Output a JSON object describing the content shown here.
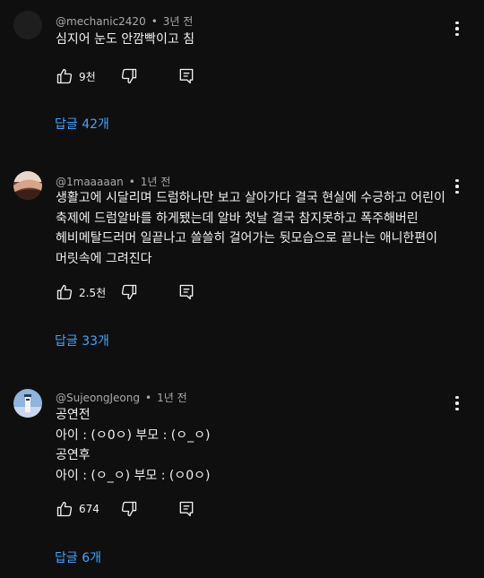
{
  "comments": [
    {
      "author": "@mechanic2420",
      "time": "3년 전",
      "lines": [
        "심지어 눈도 안깜빡이고 침"
      ],
      "likes": "9천",
      "replies": "답글 42개"
    },
    {
      "author": "@1maaaaan",
      "time": "1년 전",
      "lines": [
        "생활고에 시달리며 드럼하나만 보고 살아가다 결국 현실에 수긍하고 어린이",
        "축제에 드럼알바를 하게됐는데 알바 첫날 결국 참지못하고 폭주해버린",
        "헤비메탈드러머 일끝나고 쓸쓸히 걸어가는 뒷모습으로 끝나는 애니한편이",
        "머릿속에 그려진다"
      ],
      "likes": "2.5천",
      "replies": "답글 33개"
    },
    {
      "author": "@SujeongJeong",
      "time": "1년 전",
      "lines": [
        "공연전",
        "아이 : (ㅇ0ㅇ) 부모 : (ㅇ_ㅇ)",
        "공연후",
        "아이 : (ㅇ_ㅇ) 부모 : (ㅇ0ㅇ)"
      ],
      "likes": "674",
      "replies": "답글 6개"
    }
  ],
  "icons": {
    "like": "thumbs-up-icon",
    "dislike": "thumbs-down-icon",
    "reply": "comment-icon",
    "more": "more-vertical-icon"
  },
  "colors": {
    "background": "#0f0f0f",
    "link": "#3ea6ff",
    "meta": "#aaaaaa"
  }
}
